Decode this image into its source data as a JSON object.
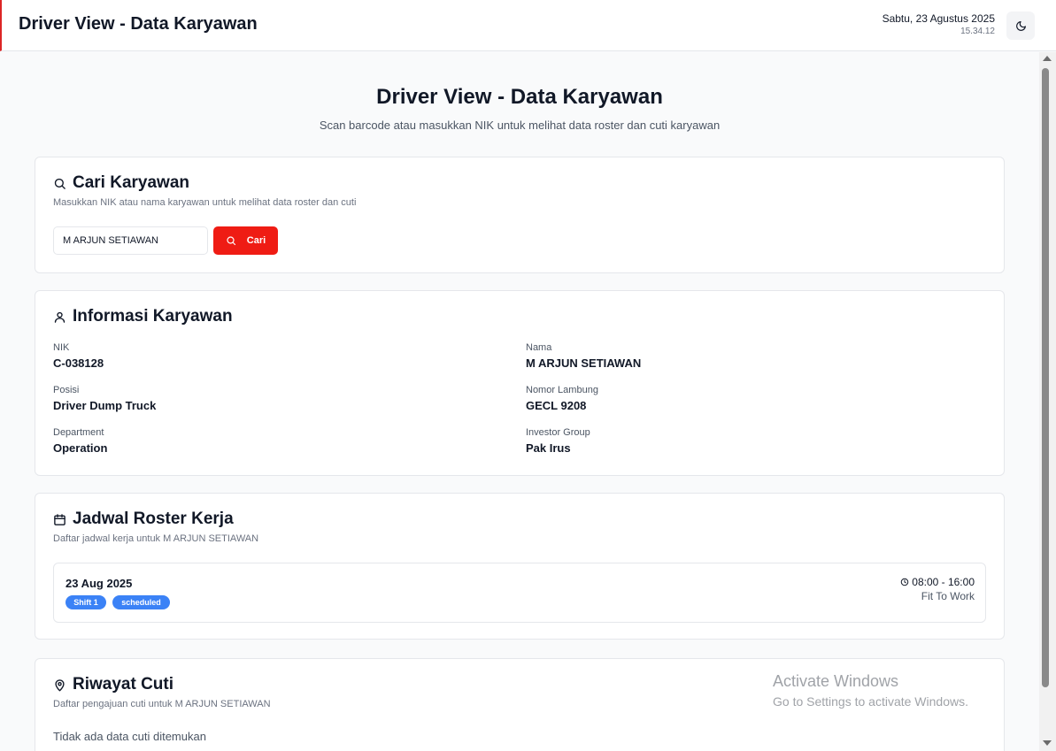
{
  "header": {
    "title": "Driver View - Data Karyawan",
    "date": "Sabtu, 23 Agustus 2025",
    "time": "15.34.12",
    "theme_icon": "moon-icon"
  },
  "page": {
    "title": "Driver View - Data Karyawan",
    "subtitle": "Scan barcode atau masukkan NIK untuk melihat data roster dan cuti karyawan"
  },
  "search": {
    "title": "Cari Karyawan",
    "description": "Masukkan NIK atau nama karyawan untuk melihat data roster dan cuti",
    "value": "M ARJUN SETIAWAN",
    "button_label": "Cari"
  },
  "employee": {
    "title": "Informasi Karyawan",
    "fields": [
      {
        "label": "NIK",
        "value": "C-038128"
      },
      {
        "label": "Nama",
        "value": "M ARJUN SETIAWAN"
      },
      {
        "label": "Posisi",
        "value": "Driver Dump Truck"
      },
      {
        "label": "Nomor Lambung",
        "value": "GECL 9208"
      },
      {
        "label": "Department",
        "value": "Operation"
      },
      {
        "label": "Investor Group",
        "value": "Pak Irus"
      }
    ]
  },
  "roster": {
    "title": "Jadwal Roster Kerja",
    "description": "Daftar jadwal kerja untuk M ARJUN SETIAWAN",
    "items": [
      {
        "date": "23 Aug 2025",
        "shift": "Shift 1",
        "status_badge": "scheduled",
        "time": "08:00 - 16:00",
        "status": "Fit To Work"
      }
    ]
  },
  "leave": {
    "title": "Riwayat Cuti",
    "description": "Daftar pengajuan cuti untuk M ARJUN SETIAWAN",
    "empty": "Tidak ada data cuti ditemukan"
  },
  "watermark": {
    "title": "Activate Windows",
    "subtitle": "Go to Settings to activate Windows."
  },
  "colors": {
    "accent": "#ef1c14",
    "badge": "#3b82f6"
  }
}
